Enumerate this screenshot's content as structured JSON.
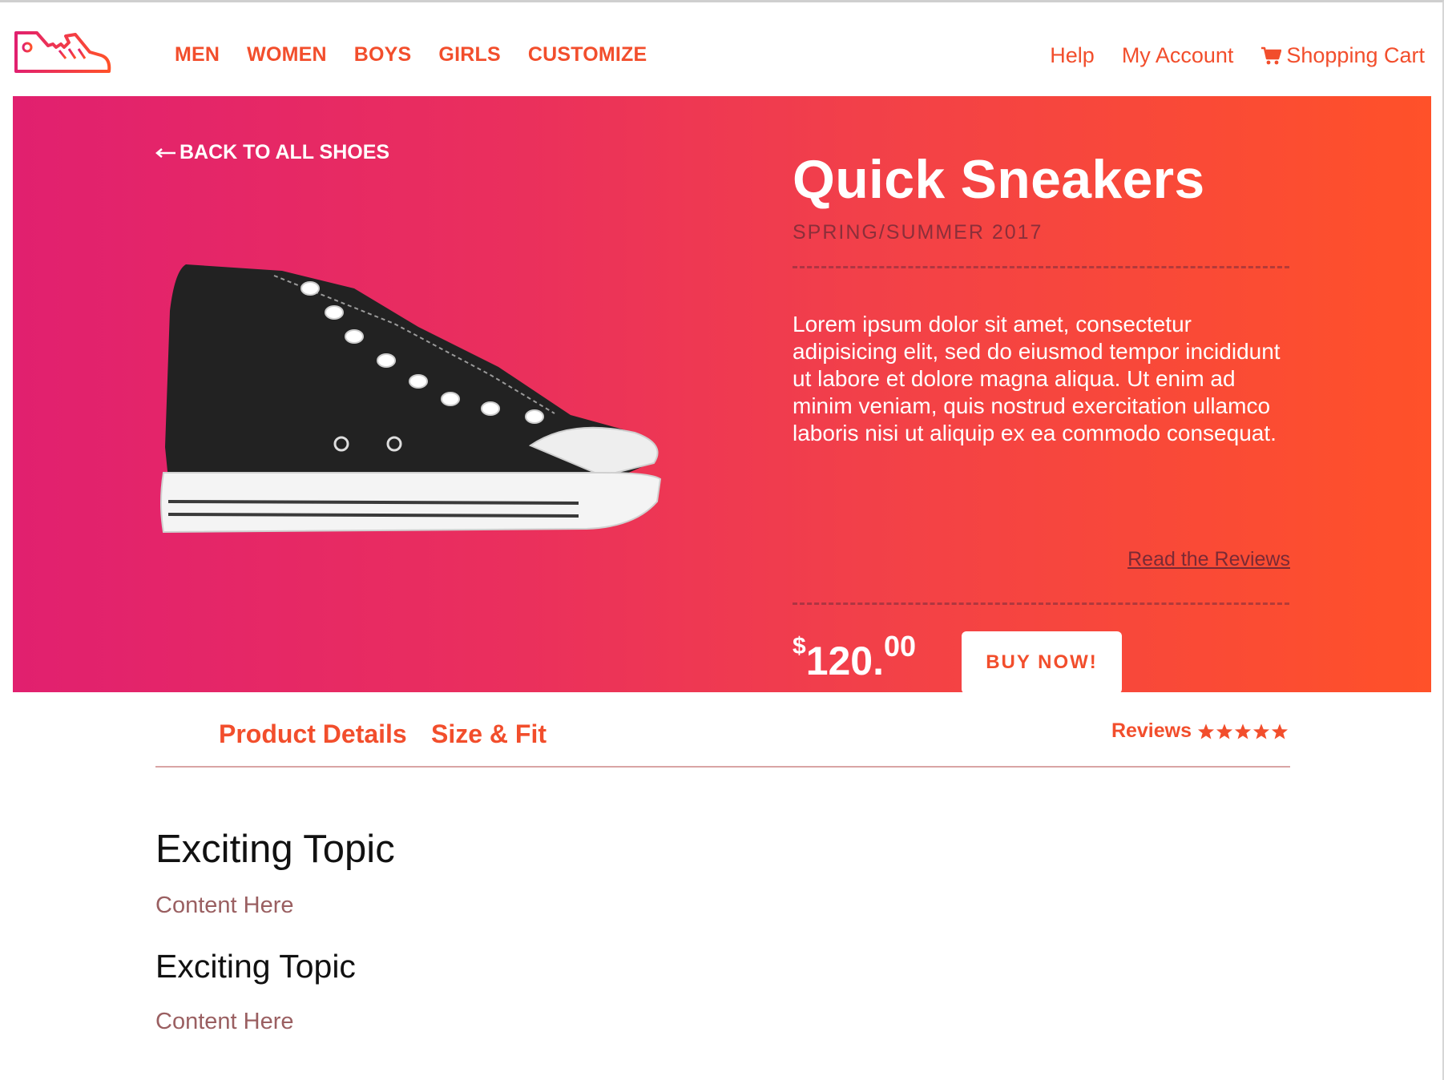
{
  "nav": {
    "main": [
      "MEN",
      "WOMEN",
      "BOYS",
      "GIRLS",
      "CUSTOMIZE"
    ],
    "help": "Help",
    "account": "My Account",
    "cart": "Shopping Cart"
  },
  "hero": {
    "back": "BACK TO ALL SHOES",
    "title": "Quick Sneakers",
    "season": "SPRING/SUMMER 2017",
    "description": "Lorem ipsum dolor sit amet, consectetur adipisicing elit, sed do eiusmod tempor incididunt ut labore et dolore magna aliqua. Ut enim ad minim veniam, quis nostrud exercitation ullamco laboris nisi ut aliquip ex ea commodo consequat.",
    "reviews_link": "Read the Reviews",
    "price": {
      "currency": "$",
      "whole": "120.",
      "cents": "00"
    },
    "buy": "BUY NOW!"
  },
  "tabs": {
    "details": "Product Details",
    "size": "Size & Fit",
    "reviews": "Reviews",
    "rating": 5
  },
  "content": [
    {
      "heading": "Exciting Topic",
      "text": "Content Here"
    },
    {
      "heading": "Exciting Topic",
      "text": "Content Here"
    }
  ],
  "colors": {
    "accent": "#f24e2c",
    "gradient_start": "#e1206f",
    "gradient_end": "#ff5129"
  }
}
